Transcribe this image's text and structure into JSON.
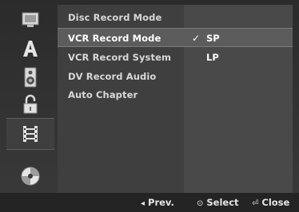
{
  "menu": {
    "items": [
      {
        "label": "Disc Record Mode"
      },
      {
        "label": "VCR Record Mode"
      },
      {
        "label": "VCR Record System"
      },
      {
        "label": "DV Record Audio"
      },
      {
        "label": "Auto Chapter"
      }
    ],
    "selected": "VCR Record Mode"
  },
  "options": {
    "items": [
      {
        "label": "SP",
        "checked": true
      },
      {
        "label": "LP",
        "checked": false
      }
    ],
    "check_glyph": "✓"
  },
  "icons": [
    "display-icon",
    "language-icon",
    "audio-speaker-icon",
    "lock-icon",
    "film-record-icon",
    "disc-icon"
  ],
  "icons_selected": "film-record-icon",
  "footer": {
    "prev_glyph": "◂",
    "prev_label": "Prev.",
    "select_glyph": "⊙",
    "select_label": "Select",
    "close_glyph": "⏎",
    "close_label": "Close"
  },
  "colors": {
    "background": "#333333",
    "selected_row": "#5c5c5c",
    "text": "#ffffff"
  }
}
